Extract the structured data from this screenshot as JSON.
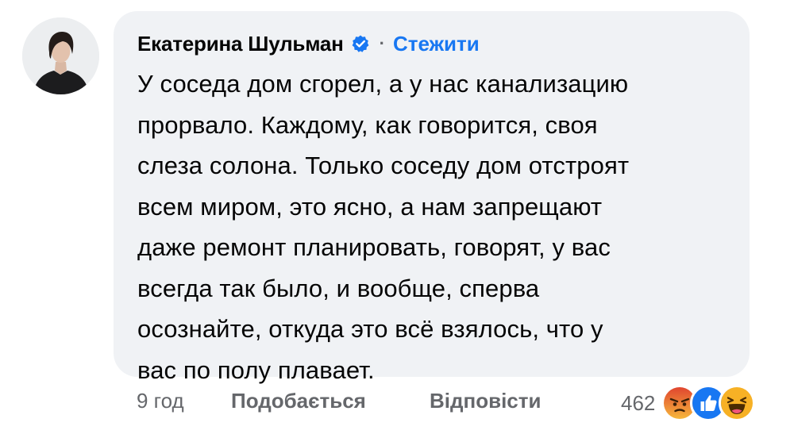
{
  "comment": {
    "author": "Екатерина Шульман",
    "follow_label": "Стежити",
    "separator": "·",
    "text_lines": [
      "У соседа дом сгорел, а у нас канализацию",
      "прорвало. Каждому, как говорится, своя",
      "слеза солона. Только соседу дом отстроят",
      "всем миром, это ясно, а нам запрещают",
      "даже ремонт планировать, говорят, у вас",
      "всегда так было, и вообще, сперва",
      "осознайте, откуда это всё взялось, что у",
      "вас по полу плавает."
    ]
  },
  "footer": {
    "time": "9 год",
    "like_label": "Подобається",
    "reply_label": "Відповісти",
    "reaction_count": "462",
    "reaction_icons": [
      "angry-reaction-icon",
      "like-reaction-icon",
      "haha-reaction-icon"
    ]
  },
  "colors": {
    "bubble_bg": "#f0f2f5",
    "link_blue": "#1877f2",
    "secondary_text": "#65676b",
    "angry_red": "#e9710f",
    "like_blue": "#1877f2",
    "haha_yellow": "#f7b125"
  }
}
